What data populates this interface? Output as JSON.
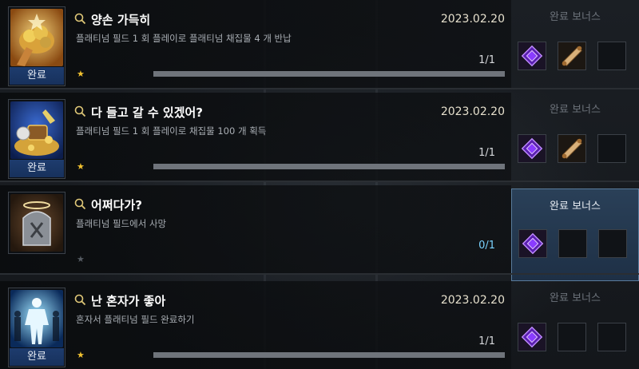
{
  "achievements": [
    {
      "title": "양손 가득히",
      "description": "플래티넘 필드 1 회 플레이로 플래티넘 채집물 4 개 반납",
      "date": "2023.02.20",
      "progress": "1/1",
      "progress_value": 1.0,
      "status_label": "완료",
      "star": "★",
      "icon": "gold-hand-icon",
      "bonus_title": "완료 보너스",
      "rewards": [
        "purple-gem-icon",
        "scroll-icon",
        "empty-slot"
      ]
    },
    {
      "title": "다 들고 갈 수 있겠어?",
      "description": "플래티넘 필드 1 회 플레이로 채집물 100 개 획득",
      "date": "2023.02.20",
      "progress": "1/1",
      "progress_value": 1.0,
      "status_label": "완료",
      "star": "★",
      "icon": "treasure-pile-icon",
      "bonus_title": "완료 보너스",
      "rewards": [
        "purple-gem-icon",
        "scroll-icon",
        "empty-slot"
      ]
    },
    {
      "title": "어쩌다가?",
      "description": "플래티넘 필드에서 사망",
      "date": "",
      "progress": "0/1",
      "progress_value": 0.0,
      "status_label": "",
      "star": "★",
      "icon": "tombstone-icon",
      "bonus_title": "완료 보너스",
      "rewards": [
        "purple-gem-icon",
        "empty-slot",
        "empty-slot"
      ]
    },
    {
      "title": "난 혼자가 좋아",
      "description": "혼자서 플래티넘 필드 완료하기",
      "date": "2023.02.20",
      "progress": "1/1",
      "progress_value": 1.0,
      "status_label": "완료",
      "star": "★",
      "icon": "glowing-figure-icon",
      "bonus_title": "완료 보너스",
      "rewards": [
        "purple-gem-icon",
        "empty-slot",
        "empty-slot"
      ]
    }
  ],
  "colors": {
    "accent_blue": "#7ad3ff",
    "star_gold": "#f2c230",
    "status_blue": "#1e3c6e",
    "gem_purple": "#8a3cff"
  }
}
